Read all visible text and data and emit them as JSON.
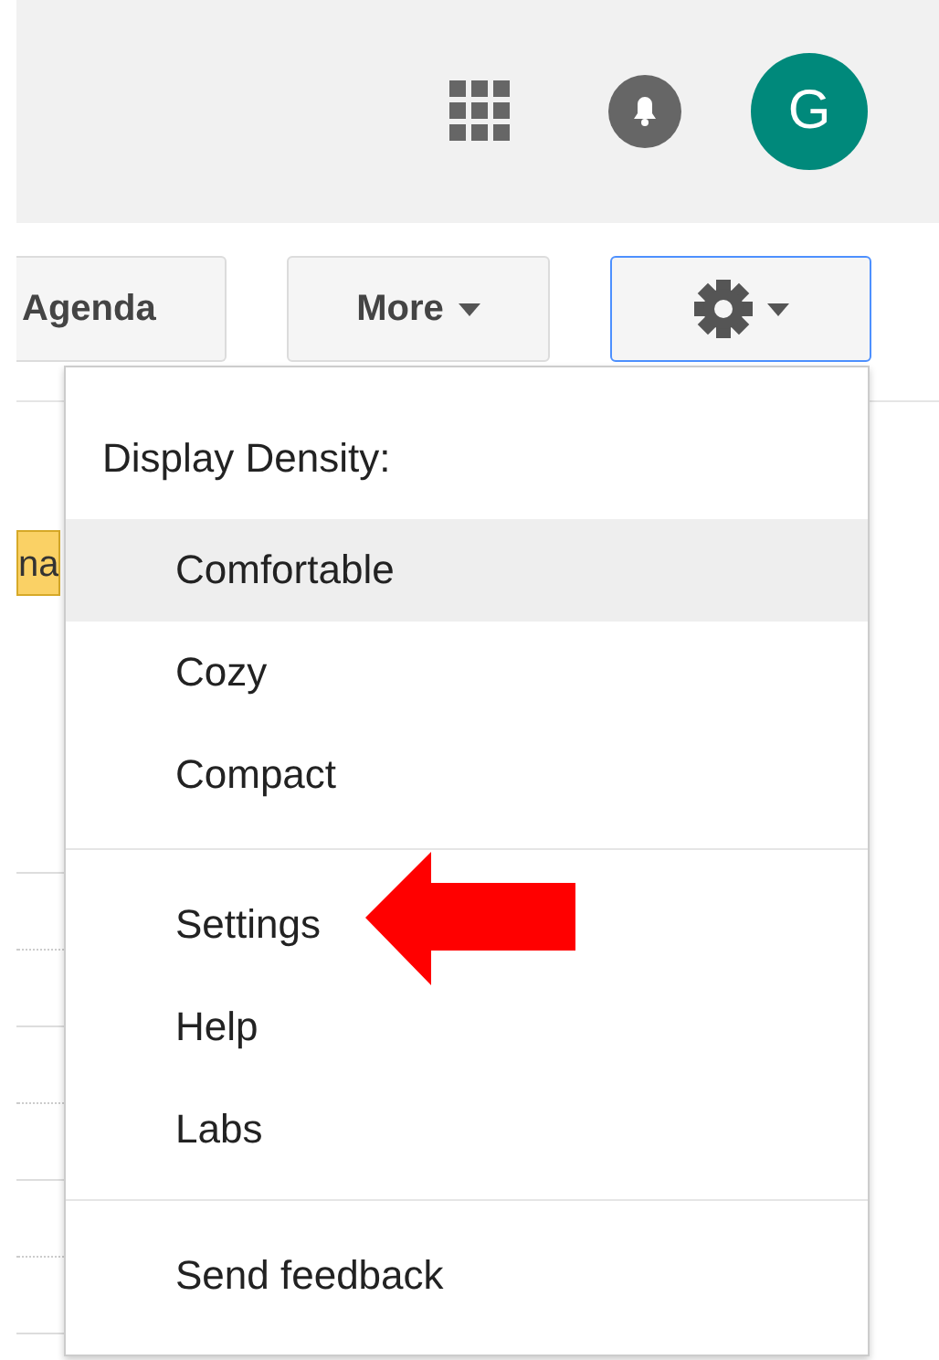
{
  "header": {
    "avatar_letter": "G"
  },
  "toolbar": {
    "buttons": [
      {
        "label": "Agenda",
        "kind": "text",
        "selected": false
      },
      {
        "label": "More",
        "kind": "dropdown",
        "selected": false
      },
      {
        "kind": "settings",
        "selected": true
      }
    ]
  },
  "calendar": {
    "event_chip": {
      "label": "na"
    }
  },
  "menu": {
    "heading": "Display Density:",
    "density_options": [
      {
        "label": "Comfortable",
        "selected": true
      },
      {
        "label": "Cozy",
        "selected": false
      },
      {
        "label": "Compact",
        "selected": false
      }
    ],
    "actions": [
      "Settings",
      "Help",
      "Labs"
    ],
    "footer_items": [
      "Send feedback"
    ]
  },
  "annotation": {
    "kind": "arrow"
  }
}
